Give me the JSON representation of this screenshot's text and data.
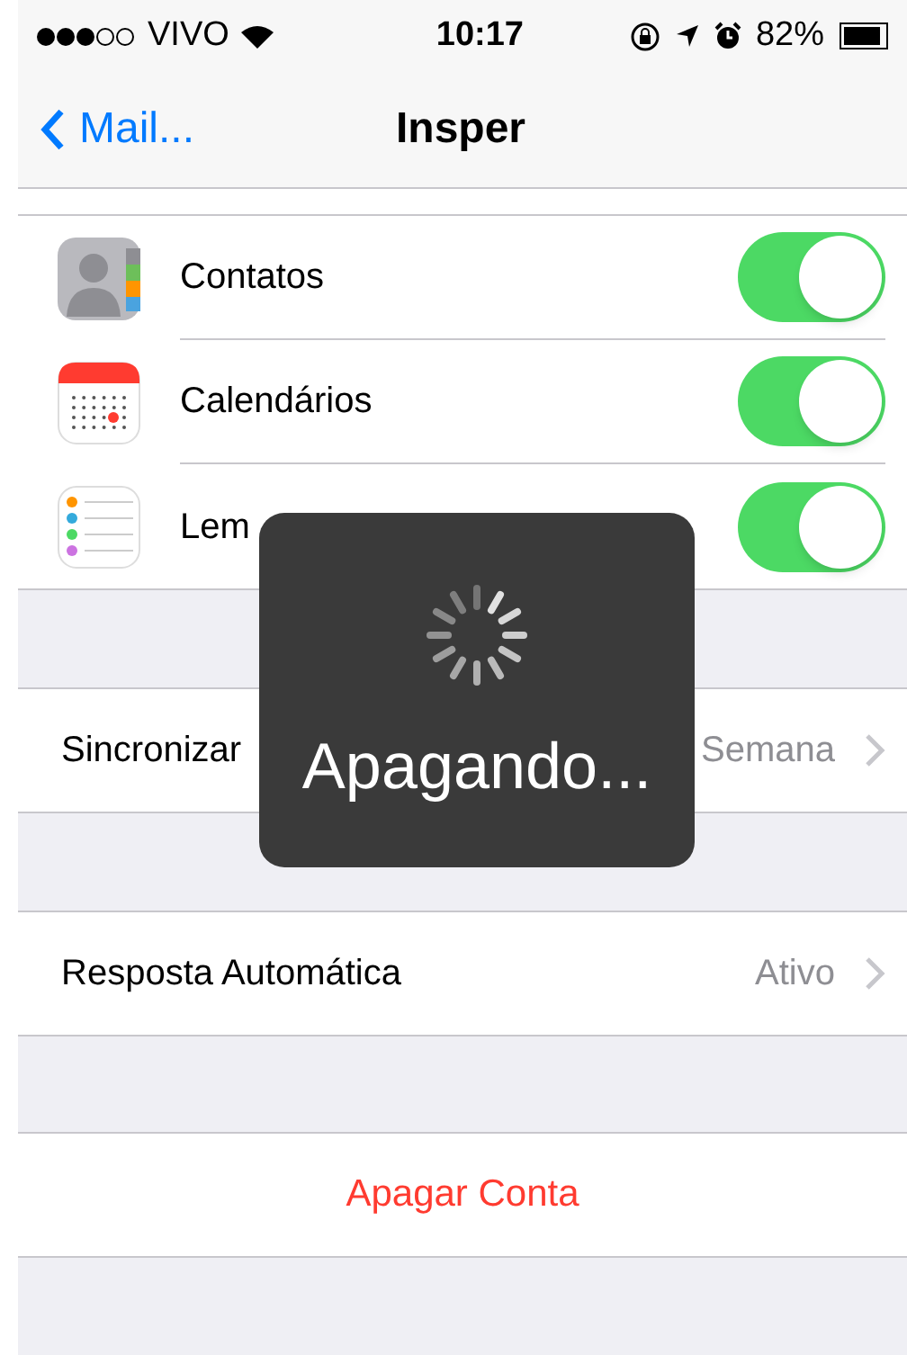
{
  "status_bar": {
    "carrier": "VIVO",
    "time": "10:17",
    "battery": "82%"
  },
  "nav": {
    "back": "Mail...",
    "title": "Insper"
  },
  "toggles": [
    {
      "kind": "contacts",
      "label": "Contatos",
      "on": true
    },
    {
      "kind": "calendar",
      "label": "Calendários",
      "on": true
    },
    {
      "kind": "reminders",
      "label": "Lem",
      "on": true
    }
  ],
  "settings": [
    {
      "label": "Sincronizar",
      "value": "Semana"
    },
    {
      "label": "Resposta Automática",
      "value": "Ativo"
    }
  ],
  "delete_button": "Apagar Conta",
  "hud": {
    "text": "Apagando..."
  }
}
